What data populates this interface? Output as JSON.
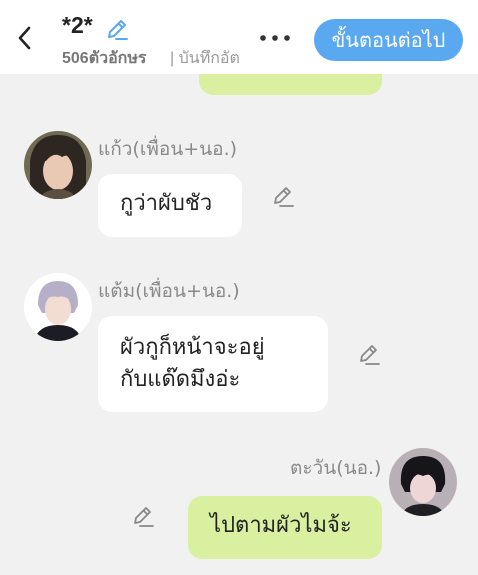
{
  "header": {
    "title": "*2*",
    "char_count": "506ตัวอักษร",
    "status": "| บันทึกอัตโนมัติ",
    "next_label": "ขั้นตอนต่อไป",
    "icons": {
      "back": "chevron-left-icon",
      "edit": "pencil-icon",
      "more": "more-horizontal-icon"
    },
    "accent_color": "#5aa8f0"
  },
  "messages": [
    {
      "speaker": "แก้ว(เพื่อน+นอ.)",
      "text": "กูว่าผับชัว",
      "side": "left"
    },
    {
      "speaker": "แต้ม(เพื่อน+นอ.)",
      "lines": [
        "ผัวกูก็หน้าจะอยู่",
        "กับแด๊ดมึงอ่ะ"
      ],
      "side": "left"
    },
    {
      "speaker": "ตะวัน(นอ.)",
      "text": "ไปตามผัวไมจ้ะ",
      "side": "right"
    }
  ],
  "colors": {
    "background": "#f1f1f1",
    "my_bubble": "#d8f0a0",
    "other_bubble": "#ffffff",
    "name_text": "#8a8a8a"
  }
}
